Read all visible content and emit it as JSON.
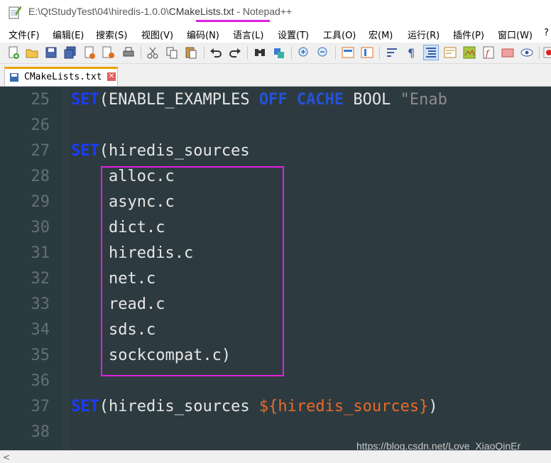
{
  "window": {
    "title_prefix": "E:\\QtStudyTest\\04\\hiredis-1.0.0\\",
    "title_file": "CMakeLists.txt",
    "title_suffix": " - Notepad++",
    "icon": "notepad-app-icon"
  },
  "menu": [
    "文件(F)",
    "编辑(E)",
    "搜索(S)",
    "视图(V)",
    "编码(N)",
    "语言(L)",
    "设置(T)",
    "工具(O)",
    "宏(M)",
    "运行(R)",
    "插件(P)",
    "窗口(W)",
    "?"
  ],
  "tab": {
    "label": "CMakeLists.txt",
    "close": "✕"
  },
  "editor": {
    "lines": [
      {
        "no": "25",
        "tokens": [
          {
            "t": "SET",
            "c": "kw-blue"
          },
          {
            "t": "(ENABLE_EXAMPLES ",
            "c": ""
          },
          {
            "t": "OFF",
            "c": "kw-navy"
          },
          {
            "t": " ",
            "c": ""
          },
          {
            "t": "CACHE",
            "c": "kw-navy"
          },
          {
            "t": " BOOL ",
            "c": ""
          },
          {
            "t": "\"Enab",
            "c": "str"
          }
        ]
      },
      {
        "no": "26",
        "tokens": []
      },
      {
        "no": "27",
        "tokens": [
          {
            "t": "SET",
            "c": "kw-blue"
          },
          {
            "t": "(hiredis_sources",
            "c": ""
          }
        ]
      },
      {
        "no": "28",
        "tokens": [
          {
            "t": "    alloc.c",
            "c": ""
          }
        ]
      },
      {
        "no": "29",
        "tokens": [
          {
            "t": "    async.c",
            "c": ""
          }
        ]
      },
      {
        "no": "30",
        "tokens": [
          {
            "t": "    dict.c",
            "c": ""
          }
        ]
      },
      {
        "no": "31",
        "tokens": [
          {
            "t": "    hiredis.c",
            "c": ""
          }
        ]
      },
      {
        "no": "32",
        "tokens": [
          {
            "t": "    net.c",
            "c": ""
          }
        ]
      },
      {
        "no": "33",
        "tokens": [
          {
            "t": "    read.c",
            "c": ""
          }
        ]
      },
      {
        "no": "34",
        "tokens": [
          {
            "t": "    sds.c",
            "c": ""
          }
        ]
      },
      {
        "no": "35",
        "tokens": [
          {
            "t": "    sockcompat.c)",
            "c": ""
          }
        ]
      },
      {
        "no": "36",
        "tokens": []
      },
      {
        "no": "37",
        "tokens": [
          {
            "t": "SET",
            "c": "kw-blue"
          },
          {
            "t": "(hiredis_sources ",
            "c": ""
          },
          {
            "t": "${hiredis_sources}",
            "c": "var"
          },
          {
            "t": ")",
            "c": ""
          }
        ]
      },
      {
        "no": "38",
        "tokens": []
      }
    ]
  },
  "watermark": "https://blog.csdn.net/Love_XiaoQinEr",
  "colors": {
    "editor_bg": "#2d3b40",
    "keyword": "#1a3cff",
    "variable": "#e86a2a",
    "highlight": "#e020e0"
  }
}
